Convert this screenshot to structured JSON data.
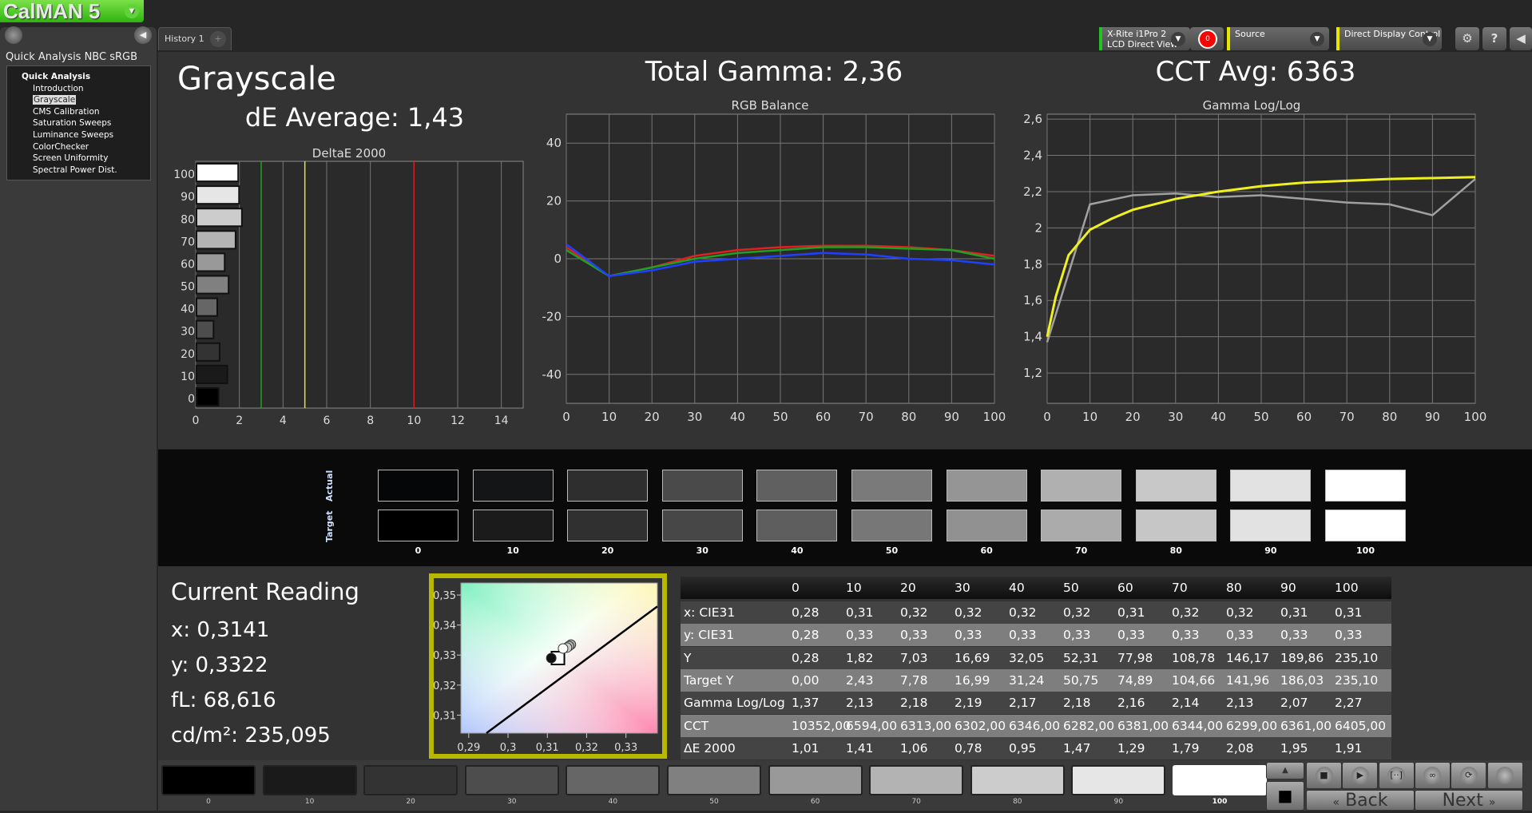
{
  "app": {
    "logo": "CalMAN 5"
  },
  "sidebar": {
    "title": "Quick Analysis NBC sRGB",
    "root": "Quick Analysis",
    "items": [
      "Introduction",
      "Grayscale",
      "CMS Calibration",
      "Saturation Sweeps",
      "Luminance Sweeps",
      "ColorChecker",
      "Screen Uniformity",
      "Spectral Power Dist."
    ],
    "selected": "Grayscale"
  },
  "tabs": {
    "history": "History 1",
    "add": "+"
  },
  "toolbar": {
    "meter_line1": "X-Rite i1Pro 2",
    "meter_line2": "LCD Direct View",
    "meter_count": "0",
    "source": "Source",
    "display": "Direct Display Control",
    "accent_green": "#22c322",
    "accent_yellow": "#e6e600"
  },
  "header": {
    "page_title": "Grayscale",
    "total_gamma": "Total Gamma: 2,36",
    "cct_avg": "CCT Avg: 6363",
    "de_avg": "dE Average: 1,43"
  },
  "chart_data": [
    {
      "type": "bar",
      "orientation": "horizontal",
      "title": "DeltaE 2000",
      "categories": [
        "0",
        "10",
        "20",
        "30",
        "40",
        "50",
        "60",
        "70",
        "80",
        "90",
        "100"
      ],
      "values": [
        1.01,
        1.41,
        1.06,
        0.78,
        0.95,
        1.47,
        1.29,
        1.79,
        2.08,
        1.95,
        1.91
      ],
      "xlim": [
        0,
        15
      ],
      "xticks": [
        "0",
        "2",
        "4",
        "6",
        "8",
        "10",
        "12",
        "14"
      ],
      "thresholds": [
        {
          "value": 3,
          "color": "#1fa11f"
        },
        {
          "value": 5,
          "color": "#e0e040"
        },
        {
          "value": 10,
          "color": "#d02020"
        }
      ],
      "grid": true
    },
    {
      "type": "line",
      "title": "RGB Balance",
      "x": [
        0,
        10,
        20,
        30,
        40,
        50,
        60,
        70,
        80,
        90,
        100
      ],
      "xticks": [
        "0",
        "10",
        "20",
        "30",
        "40",
        "50",
        "60",
        "70",
        "80",
        "90",
        "100"
      ],
      "yticks": [
        "40",
        "20",
        "0",
        "-20",
        "-40"
      ],
      "ylim": [
        -50,
        50
      ],
      "grid": true,
      "series": [
        {
          "color": "#e02020",
          "values": [
            4,
            -6,
            -3,
            1,
            3,
            4,
            4.5,
            4.5,
            4,
            3,
            1
          ]
        },
        {
          "color": "#20a020",
          "values": [
            3,
            -6,
            -3,
            0,
            2,
            3,
            4,
            4,
            3.5,
            3,
            0
          ]
        },
        {
          "color": "#2040ff",
          "values": [
            5,
            -6,
            -4,
            -1,
            0,
            1,
            2,
            1.5,
            0,
            -0.5,
            -2
          ]
        }
      ]
    },
    {
      "type": "line",
      "title": "Gamma Log/Log",
      "xticks": [
        "0",
        "10",
        "20",
        "30",
        "40",
        "50",
        "60",
        "70",
        "80",
        "90",
        "100"
      ],
      "yticks": [
        "2,6",
        "2,4",
        "2,2",
        "2",
        "1,8",
        "1,6",
        "1,4",
        "1,2"
      ],
      "ylim": [
        1.033,
        2.627
      ],
      "grid": true,
      "series": [
        {
          "color": "#a0a0a0",
          "x": [
            0,
            10,
            20,
            30,
            40,
            50,
            60,
            70,
            80,
            90,
            100
          ],
          "values": [
            1.37,
            2.13,
            2.18,
            2.19,
            2.17,
            2.18,
            2.16,
            2.14,
            2.13,
            2.07,
            2.27
          ]
        },
        {
          "color": "#f0f020",
          "x": [
            0,
            2,
            5,
            10,
            15,
            20,
            30,
            40,
            50,
            60,
            70,
            80,
            90,
            100
          ],
          "values": [
            1.4,
            1.62,
            1.85,
            1.99,
            2.05,
            2.1,
            2.16,
            2.2,
            2.23,
            2.25,
            2.26,
            2.27,
            2.275,
            2.28
          ]
        }
      ]
    },
    {
      "type": "scatter",
      "title": "",
      "xticks": [
        "0,29",
        "0,3",
        "0,31",
        "0,32",
        "0,33"
      ],
      "yticks": [
        "0,35",
        "0,34",
        "0,33",
        "0,32",
        "0,31"
      ],
      "xlim": [
        0.288,
        0.338
      ],
      "ylim": [
        0.304,
        0.354
      ],
      "target": [
        0.3127,
        0.329
      ],
      "points": [
        [
          0.311,
          0.329,
          "#111"
        ],
        [
          0.316,
          0.3335,
          "#aaa"
        ],
        [
          0.3155,
          0.333,
          "#bbb"
        ],
        [
          0.315,
          0.3325,
          "#ccc"
        ],
        [
          0.314,
          0.3322,
          "#fff"
        ]
      ],
      "locus": [
        [
          0.2945,
          0.304
        ],
        [
          0.338,
          0.3462
        ]
      ]
    }
  ],
  "swatches": {
    "actual_label": "Actual",
    "target_label": "Target",
    "levels": [
      "0",
      "10",
      "20",
      "30",
      "40",
      "50",
      "60",
      "70",
      "80",
      "90",
      "100"
    ],
    "actual": [
      "#050608",
      "#141516",
      "#2e2e2e",
      "#4a4a4a",
      "#606060",
      "#7a7a7a",
      "#959595",
      "#b0b0b0",
      "#c8c8c8",
      "#e2e2e2",
      "#ffffff"
    ],
    "target": [
      "#000000",
      "#1b1b1b",
      "#303030",
      "#474747",
      "#5e5e5e",
      "#777777",
      "#919191",
      "#ababab",
      "#c6c6c6",
      "#e2e2e2",
      "#ffffff"
    ]
  },
  "reading": {
    "title": "Current Reading",
    "x": "x: 0,3141",
    "y": "y: 0,3322",
    "fl": "fL: 68,616",
    "cdm2": "cd/m²: 235,095"
  },
  "table": {
    "columns": [
      "0",
      "10",
      "20",
      "30",
      "40",
      "50",
      "60",
      "70",
      "80",
      "90",
      "100"
    ],
    "rows": [
      {
        "label": "x: CIE31",
        "values": [
          "0,28",
          "0,31",
          "0,32",
          "0,32",
          "0,32",
          "0,32",
          "0,31",
          "0,32",
          "0,32",
          "0,31",
          "0,31"
        ]
      },
      {
        "label": "y: CIE31",
        "values": [
          "0,28",
          "0,33",
          "0,33",
          "0,33",
          "0,33",
          "0,33",
          "0,33",
          "0,33",
          "0,33",
          "0,33",
          "0,33"
        ]
      },
      {
        "label": "Y",
        "values": [
          "0,28",
          "1,82",
          "7,03",
          "16,69",
          "32,05",
          "52,31",
          "77,98",
          "108,78",
          "146,17",
          "189,86",
          "235,10"
        ]
      },
      {
        "label": "Target Y",
        "values": [
          "0,00",
          "2,43",
          "7,78",
          "16,99",
          "31,24",
          "50,75",
          "74,89",
          "104,66",
          "141,96",
          "186,03",
          "235,10"
        ]
      },
      {
        "label": "Gamma Log/Log",
        "values": [
          "1,37",
          "2,13",
          "2,18",
          "2,19",
          "2,17",
          "2,18",
          "2,16",
          "2,14",
          "2,13",
          "2,07",
          "2,27"
        ]
      },
      {
        "label": "CCT",
        "values": [
          "10352,00",
          "6594,00",
          "6313,00",
          "6302,00",
          "6346,00",
          "6282,00",
          "6381,00",
          "6344,00",
          "6299,00",
          "6361,00",
          "6405,00"
        ]
      },
      {
        "label": "ΔE 2000",
        "values": [
          "1,01",
          "1,41",
          "1,06",
          "0,78",
          "0,95",
          "1,47",
          "1,29",
          "1,79",
          "2,08",
          "1,95",
          "1,91"
        ]
      }
    ]
  },
  "bottombar": {
    "levels": [
      "0",
      "10",
      "20",
      "30",
      "40",
      "50",
      "60",
      "70",
      "80",
      "90",
      "100"
    ],
    "selected": "100",
    "back": "Back",
    "next": "Next",
    "icons": [
      "stop-icon",
      "play-icon",
      "bracket-icon",
      "loop-icon",
      "refresh-icon",
      "blank-icon"
    ]
  }
}
